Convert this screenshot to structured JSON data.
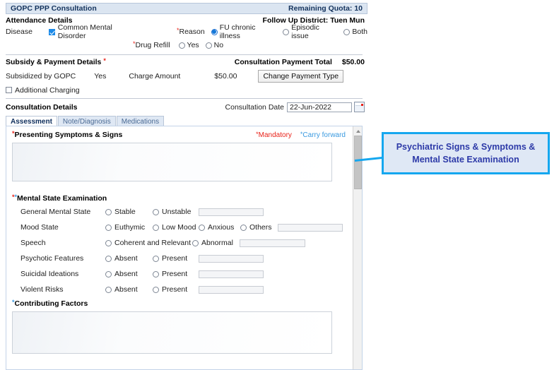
{
  "window": {
    "title": "GOPC PPP Consultation",
    "quota_label": "Remaining Quota: 10"
  },
  "attendance": {
    "heading": "Attendance Details",
    "follow_up_district": "Follow Up District: Tuen Mun",
    "disease_label": "Disease",
    "disease_checkbox_label": "Common Mental Disorder",
    "disease_checked": true,
    "reason_label": "Reason",
    "reason_options": [
      "FU chronic illness",
      "Episodic issue",
      "Both"
    ],
    "reason_selected": "FU chronic illness",
    "drug_refill_label": "Drug Refill",
    "drug_refill_options": [
      "Yes",
      "No"
    ],
    "drug_refill_selected": ""
  },
  "subsidy": {
    "heading": "Subsidy & Payment Details",
    "subsidized_label": "Subsidized by GOPC",
    "subsidized_value": "Yes",
    "charge_amount_label": "Charge Amount",
    "charge_amount_value": "$50.00",
    "additional_charging_label": "Additional Charging",
    "additional_charging_checked": false,
    "payment_total_label": "Consultation Payment Total",
    "payment_total_value": "$50.00",
    "change_payment_button": "Change Payment Type"
  },
  "consultation": {
    "heading": "Consultation Details",
    "date_label": "Consultation Date",
    "date_value": "22-Jun-2022",
    "tabs": [
      {
        "label": "Assessment",
        "active": true
      },
      {
        "label": "Note/Diagnosis",
        "active": false
      },
      {
        "label": "Medications",
        "active": false
      }
    ]
  },
  "assessment": {
    "presenting_heading": "Presenting Symptoms & Signs",
    "mandatory_label": "Mandatory",
    "carry_forward_label": "Carry forward",
    "presenting_value": "",
    "mse_heading": "Mental State Examination",
    "mse_rows": [
      {
        "label": "General Mental State",
        "options": [
          "Stable",
          "Unstable"
        ],
        "selected": "",
        "text_value": ""
      },
      {
        "label": "Mood State",
        "options": [
          "Euthymic",
          "Low Mood",
          "Anxious",
          "Others"
        ],
        "selected": "",
        "text_value": ""
      },
      {
        "label": "Speech",
        "options": [
          "Coherent and Relevant",
          "Abnormal"
        ],
        "selected": "",
        "text_value": ""
      },
      {
        "label": "Psychotic Features",
        "options": [
          "Absent",
          "Present"
        ],
        "selected": "",
        "text_value": ""
      },
      {
        "label": "Suicidal Ideations",
        "options": [
          "Absent",
          "Present"
        ],
        "selected": "",
        "text_value": ""
      },
      {
        "label": "Violent Risks",
        "options": [
          "Absent",
          "Present"
        ],
        "selected": "",
        "text_value": ""
      }
    ],
    "contributing_heading": "Contributing Factors",
    "contributing_value": ""
  },
  "callout": {
    "line1": "Psychiatric Signs & Symptoms &",
    "line2": "Mental State Examination"
  },
  "colors": {
    "title_bar": "#dbe5f1",
    "accent_blue": "#1478d8",
    "callout_border": "#15a7ef",
    "callout_fill": "#dfe8f5",
    "callout_text": "#2d3aa8",
    "mandatory_red": "#e8231a",
    "carry_forward_blue": "#3a9ae0"
  }
}
